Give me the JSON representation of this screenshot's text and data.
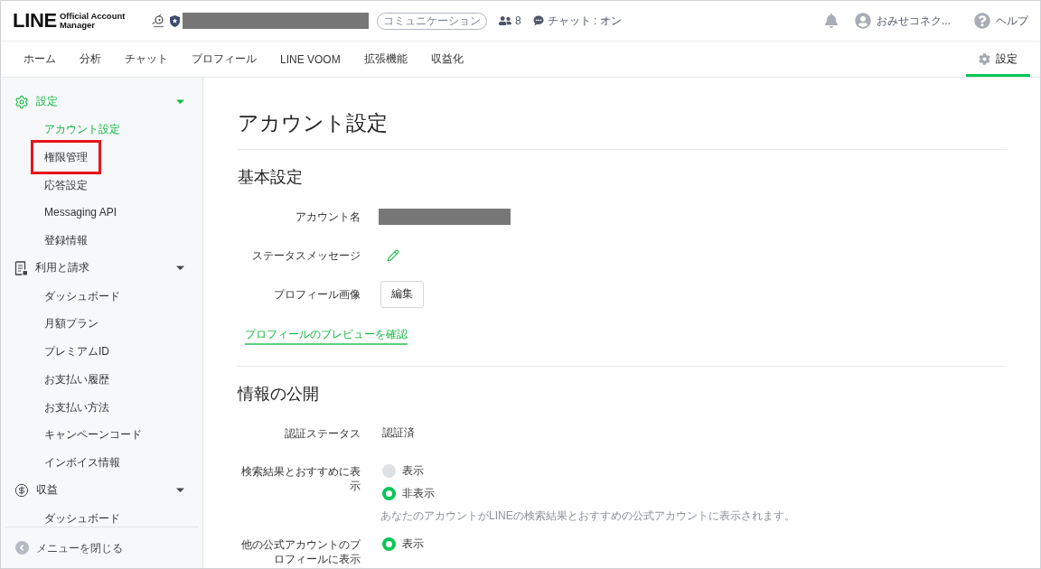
{
  "header": {
    "logo": {
      "wordmark": "LINE",
      "subtitle": "Official Account Manager"
    },
    "account": {
      "category": "コミュニケーション",
      "friends": "8",
      "chat_status": "チャット : オン"
    },
    "user": {
      "name": "おみせコネク..."
    },
    "help": "ヘルプ"
  },
  "nav": {
    "tabs": [
      {
        "label": "ホーム",
        "selected": false
      },
      {
        "label": "分析",
        "selected": false
      },
      {
        "label": "チャット",
        "selected": false
      },
      {
        "label": "プロフィール",
        "selected": false
      },
      {
        "label": "LINE VOOM",
        "selected": false
      },
      {
        "label": "拡張機能",
        "selected": false
      },
      {
        "label": "収益化",
        "selected": false
      }
    ],
    "settings_tab": {
      "label": "設定",
      "selected": true
    }
  },
  "sidebar": {
    "groups": [
      {
        "kind": "settings",
        "label": "設定",
        "selected": true,
        "expanded": true,
        "items": [
          {
            "label": "アカウント設定",
            "selected": true,
            "highlighted": false
          },
          {
            "label": "権限管理",
            "selected": false,
            "highlighted": true
          },
          {
            "label": "応答設定",
            "selected": false,
            "highlighted": false
          },
          {
            "label": "Messaging API",
            "selected": false,
            "highlighted": false
          },
          {
            "label": "登録情報",
            "selected": false,
            "highlighted": false
          }
        ]
      },
      {
        "kind": "billing",
        "label": "利用と請求",
        "selected": false,
        "expanded": true,
        "items": [
          {
            "label": "ダッシュボード",
            "selected": false,
            "highlighted": false
          },
          {
            "label": "月額プラン",
            "selected": false,
            "highlighted": false
          },
          {
            "label": "プレミアムID",
            "selected": false,
            "highlighted": false
          },
          {
            "label": "お支払い履歴",
            "selected": false,
            "highlighted": false
          },
          {
            "label": "お支払い方法",
            "selected": false,
            "highlighted": false
          },
          {
            "label": "キャンペーンコード",
            "selected": false,
            "highlighted": false
          },
          {
            "label": "インボイス情報",
            "selected": false,
            "highlighted": false
          }
        ]
      },
      {
        "kind": "revenue",
        "label": "収益",
        "selected": false,
        "expanded": true,
        "items": [
          {
            "label": "ダッシュボード",
            "selected": false,
            "highlighted": false
          }
        ]
      }
    ],
    "collapse_label": "メニューを閉じる"
  },
  "page": {
    "title": "アカウント設定",
    "sections": [
      {
        "heading": "基本設定",
        "rows": [
          {
            "kind": "redacted",
            "label": "アカウント名"
          },
          {
            "kind": "edit",
            "label": "ステータスメッセージ"
          },
          {
            "kind": "button",
            "label": "プロフィール画像",
            "button": "編集"
          }
        ],
        "link": "プロフィールのプレビューを確認"
      },
      {
        "heading": "情報の公開",
        "rows": [
          {
            "kind": "text",
            "label": "認証ステータス",
            "value": "認証済"
          },
          {
            "kind": "radio",
            "label": "検索結果とおすすめに表示",
            "options": [
              {
                "label": "表示",
                "selected": false
              },
              {
                "label": "非表示",
                "selected": true
              }
            ],
            "note": "あなたのアカウントがLINEの検索結果とおすすめの公式アカウントに表示されます。"
          },
          {
            "kind": "radio",
            "label": "他の公式アカウントのプロフィールに表示",
            "options": [
              {
                "label": "表示",
                "selected": true
              }
            ]
          }
        ]
      }
    ]
  }
}
